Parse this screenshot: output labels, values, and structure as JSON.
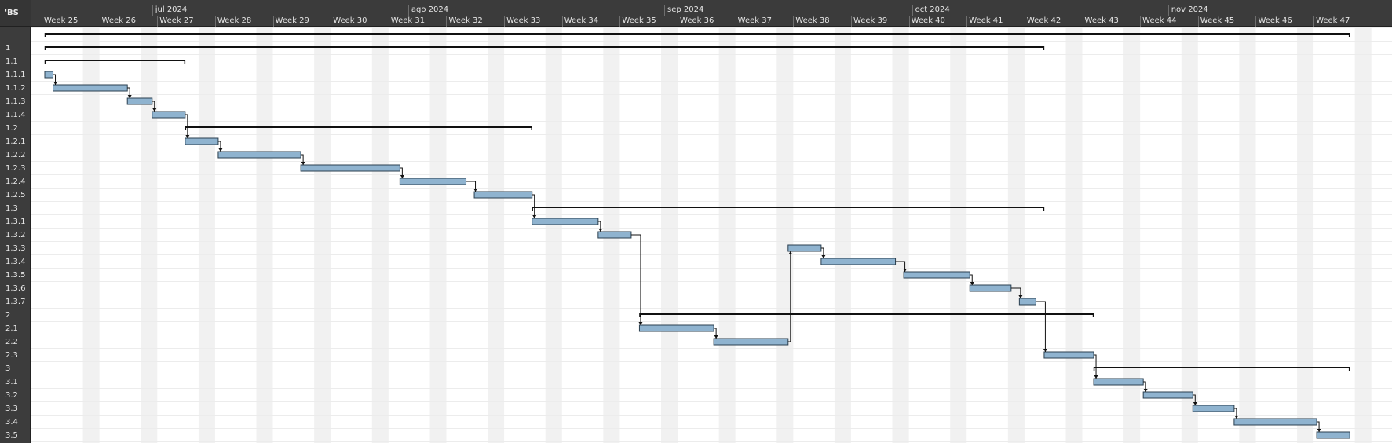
{
  "wbs_header": "'BS",
  "months": [
    "jul 2024",
    "ago 2024",
    "sep 2024",
    "oct 2024",
    "nov 2024"
  ],
  "weeks": [
    "Week 25",
    "Week 26",
    "Week 27",
    "Week 28",
    "Week 29",
    "Week 30",
    "Week 31",
    "Week 32",
    "Week 33",
    "Week 34",
    "Week 35",
    "Week 36",
    "Week 37",
    "Week 38",
    "Week 39",
    "Week 40",
    "Week 41",
    "Week 42",
    "Week 43",
    "Week 44",
    "Week 45",
    "Week 46",
    "Week 47"
  ],
  "rows": [
    "",
    "1",
    "1.1",
    "1.1.1",
    "1.1.2",
    "1.1.3",
    "1.1.4",
    "1.2",
    "1.2.1",
    "1.2.2",
    "1.2.3",
    "1.2.4",
    "1.2.5",
    "1.3",
    "1.3.1",
    "1.3.2",
    "1.3.3",
    "1.3.4",
    "1.3.5",
    "1.3.6",
    "1.3.7",
    "2",
    "2.1",
    "2.2",
    "2.3",
    "3",
    "3.1",
    "3.2",
    "3.3",
    "3.4",
    "3.5"
  ],
  "chart_data": {
    "type": "gantt",
    "start_date": "2024-06-18",
    "tasks": [
      {
        "wbs": "",
        "kind": "summary",
        "start": "2024-06-18",
        "end": "2024-11-23"
      },
      {
        "wbs": "1",
        "kind": "summary",
        "start": "2024-06-18",
        "end": "2024-10-17"
      },
      {
        "wbs": "1.1",
        "kind": "summary",
        "start": "2024-06-18",
        "end": "2024-07-05"
      },
      {
        "wbs": "1.1.1",
        "kind": "task",
        "start": "2024-06-18",
        "end": "2024-06-19"
      },
      {
        "wbs": "1.1.2",
        "kind": "task",
        "start": "2024-06-19",
        "end": "2024-06-28"
      },
      {
        "wbs": "1.1.3",
        "kind": "task",
        "start": "2024-06-28",
        "end": "2024-07-01"
      },
      {
        "wbs": "1.1.4",
        "kind": "task",
        "start": "2024-07-01",
        "end": "2024-07-05"
      },
      {
        "wbs": "1.2",
        "kind": "summary",
        "start": "2024-07-05",
        "end": "2024-08-16"
      },
      {
        "wbs": "1.2.1",
        "kind": "task",
        "start": "2024-07-05",
        "end": "2024-07-09"
      },
      {
        "wbs": "1.2.2",
        "kind": "task",
        "start": "2024-07-09",
        "end": "2024-07-19"
      },
      {
        "wbs": "1.2.3",
        "kind": "task",
        "start": "2024-07-19",
        "end": "2024-07-31"
      },
      {
        "wbs": "1.2.4",
        "kind": "task",
        "start": "2024-07-31",
        "end": "2024-08-08"
      },
      {
        "wbs": "1.2.5",
        "kind": "task",
        "start": "2024-08-09",
        "end": "2024-08-16"
      },
      {
        "wbs": "1.3",
        "kind": "summary",
        "start": "2024-08-16",
        "end": "2024-10-17"
      },
      {
        "wbs": "1.3.1",
        "kind": "task",
        "start": "2024-08-16",
        "end": "2024-08-24"
      },
      {
        "wbs": "1.3.2",
        "kind": "task",
        "start": "2024-08-24",
        "end": "2024-08-28"
      },
      {
        "wbs": "1.3.3",
        "kind": "task",
        "start": "2024-09-16",
        "end": "2024-09-20"
      },
      {
        "wbs": "1.3.4",
        "kind": "task",
        "start": "2024-09-20",
        "end": "2024-09-29"
      },
      {
        "wbs": "1.3.5",
        "kind": "task",
        "start": "2024-09-30",
        "end": "2024-10-08"
      },
      {
        "wbs": "1.3.6",
        "kind": "task",
        "start": "2024-10-08",
        "end": "2024-10-13"
      },
      {
        "wbs": "1.3.7",
        "kind": "task",
        "start": "2024-10-14",
        "end": "2024-10-16"
      },
      {
        "wbs": "2",
        "kind": "summary",
        "start": "2024-08-29",
        "end": "2024-10-23"
      },
      {
        "wbs": "2.1",
        "kind": "task",
        "start": "2024-08-29",
        "end": "2024-09-07"
      },
      {
        "wbs": "2.2",
        "kind": "task",
        "start": "2024-09-07",
        "end": "2024-09-16"
      },
      {
        "wbs": "2.3",
        "kind": "task",
        "start": "2024-10-17",
        "end": "2024-10-23"
      },
      {
        "wbs": "3",
        "kind": "summary",
        "start": "2024-10-23",
        "end": "2024-11-23"
      },
      {
        "wbs": "3.1",
        "kind": "task",
        "start": "2024-10-23",
        "end": "2024-10-29"
      },
      {
        "wbs": "3.2",
        "kind": "task",
        "start": "2024-10-29",
        "end": "2024-11-04"
      },
      {
        "wbs": "3.3",
        "kind": "task",
        "start": "2024-11-04",
        "end": "2024-11-09"
      },
      {
        "wbs": "3.4",
        "kind": "task",
        "start": "2024-11-09",
        "end": "2024-11-19"
      },
      {
        "wbs": "3.5",
        "kind": "task",
        "start": "2024-11-19",
        "end": "2024-11-23"
      }
    ],
    "dependencies": [
      [
        "1.1.1",
        "1.1.2"
      ],
      [
        "1.1.2",
        "1.1.3"
      ],
      [
        "1.1.3",
        "1.1.4"
      ],
      [
        "1.1.4",
        "1.2.1"
      ],
      [
        "1.2.1",
        "1.2.2"
      ],
      [
        "1.2.2",
        "1.2.3"
      ],
      [
        "1.2.3",
        "1.2.4"
      ],
      [
        "1.2.4",
        "1.2.5"
      ],
      [
        "1.2.5",
        "1.3.1"
      ],
      [
        "1.3.1",
        "1.3.2"
      ],
      [
        "1.3.2",
        "2.1"
      ],
      [
        "2.1",
        "2.2"
      ],
      [
        "2.2",
        "1.3.3"
      ],
      [
        "1.3.3",
        "1.3.4"
      ],
      [
        "1.3.4",
        "1.3.5"
      ],
      [
        "1.3.5",
        "1.3.6"
      ],
      [
        "1.3.6",
        "1.3.7"
      ],
      [
        "1.3.7",
        "2.3"
      ],
      [
        "2.3",
        "3.1"
      ],
      [
        "3.1",
        "3.2"
      ],
      [
        "3.2",
        "3.3"
      ],
      [
        "3.3",
        "3.4"
      ],
      [
        "3.4",
        "3.5"
      ]
    ]
  },
  "colors": {
    "task_fill": "#8fb3cf",
    "task_border": "#2b3f4f",
    "summary": "#111111",
    "header_bg": "#3b3b3b",
    "weekend_shade": "#f1f1f1",
    "row_line": "#ececec"
  }
}
